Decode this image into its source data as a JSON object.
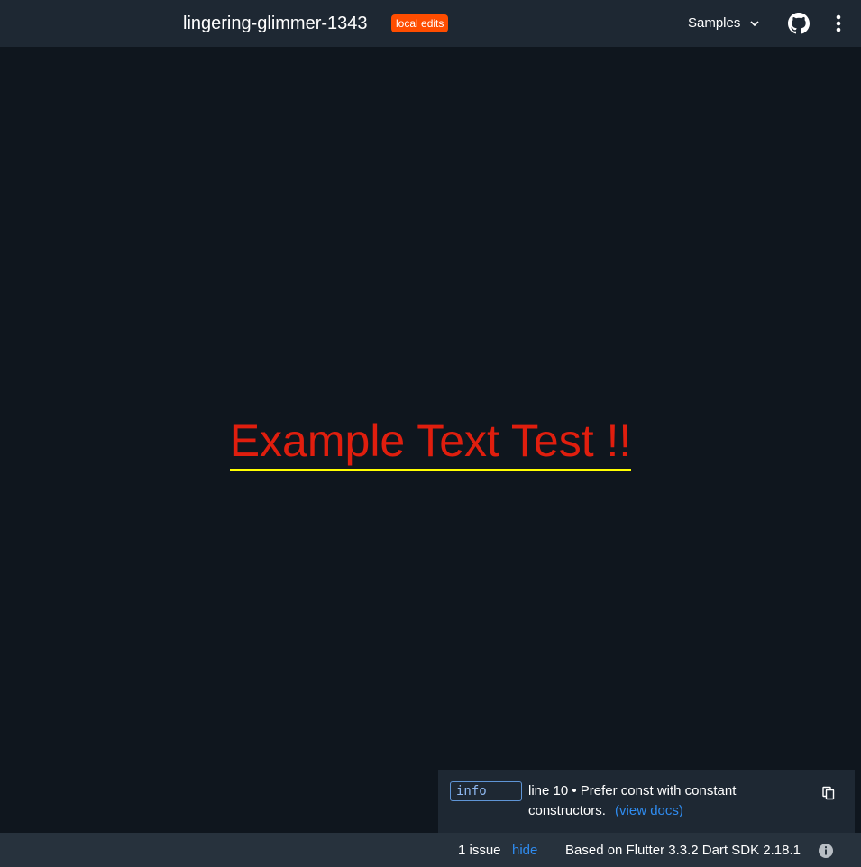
{
  "header": {
    "title": "lingering-glimmer-1343",
    "badge": "local edits",
    "samples_label": "Samples",
    "icons": [
      "chevron-down-icon",
      "github-icon",
      "more-vert-icon"
    ]
  },
  "output": {
    "text": "Example Text Test !!",
    "text_color": "#e01e0e",
    "underline_color": "#ffff00"
  },
  "issue": {
    "severity": "info",
    "message": "line 10 • Prefer const with constant constructors.",
    "docs_link": "(view docs)",
    "copy_icon": "copy-icon"
  },
  "status": {
    "issues_count": "1 issue",
    "hide_label": "hide",
    "version": "Based on Flutter 3.3.2 Dart SDK 2.18.1",
    "info_icon": "info-icon"
  },
  "colors": {
    "accent_link": "#2f8cf0",
    "badge_bg": "#ff4d00",
    "background": "#0f161e"
  }
}
